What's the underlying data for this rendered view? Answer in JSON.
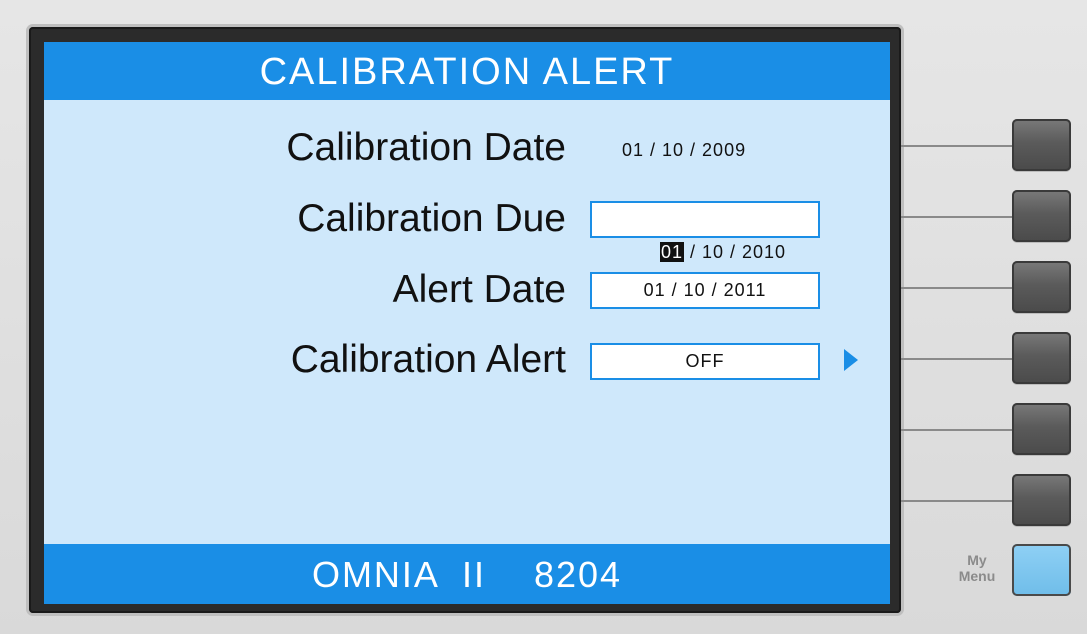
{
  "screen": {
    "title": "CALIBRATION ALERT",
    "footer": "OMNIA  II    8204"
  },
  "rows": [
    {
      "label": "Calibration Date",
      "value": "01 / 10 / 2009",
      "editable": false
    },
    {
      "label": "Calibration Due",
      "value_cursor": "01",
      "value_rest": " / 10 / 2010",
      "editable": true,
      "selected": true
    },
    {
      "label": "Alert Date",
      "value": "01 / 10 / 2011",
      "editable": true
    },
    {
      "label": "Calibration Alert",
      "value": "OFF",
      "editable": true,
      "has_arrow": true
    }
  ],
  "side_panel": {
    "soft_key_count": 6,
    "my_menu_label_line1": "My",
    "my_menu_label_line2": "Menu"
  },
  "colors": {
    "accent_blue": "#1a8ee6",
    "screen_bg": "#cfe8fb",
    "my_menu_key": "#7ac6ef",
    "soft_key": "#5b5b5b"
  },
  "icons": {
    "arrow": "right-triangle-icon"
  }
}
